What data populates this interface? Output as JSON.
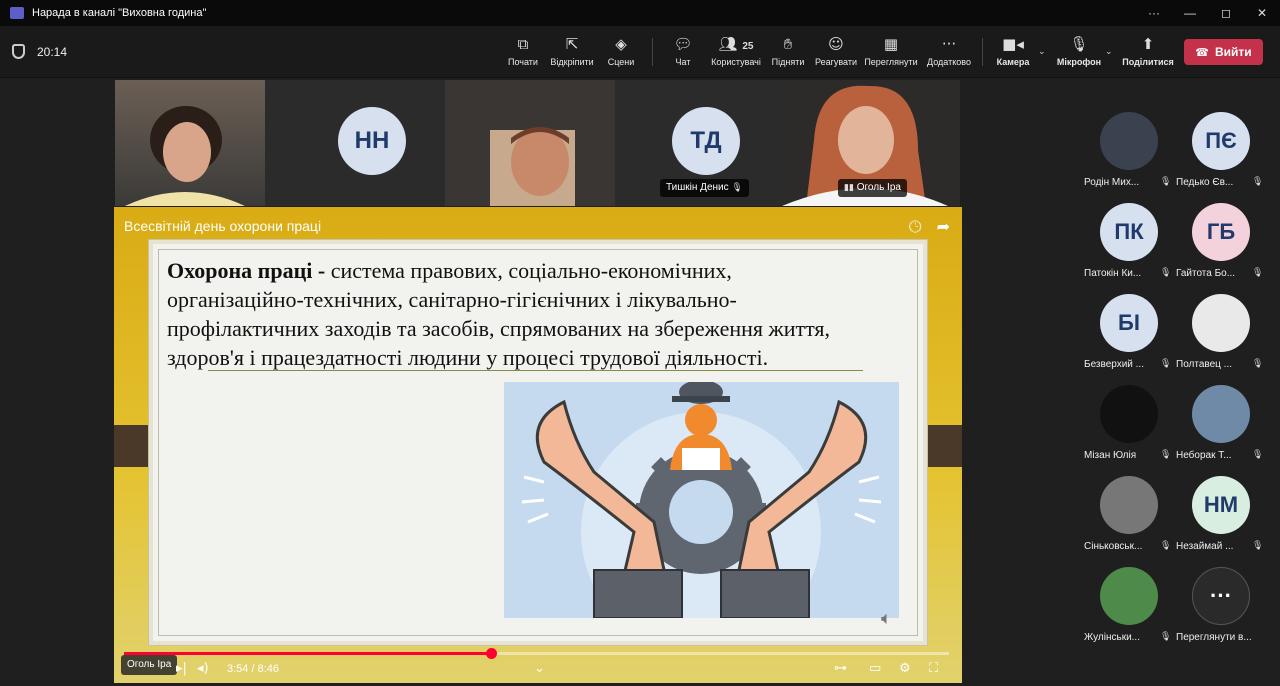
{
  "window": {
    "title": "Нарада в каналі \"Виховна година\"",
    "controls": [
      "···",
      "—",
      "◻",
      "✕"
    ]
  },
  "meeting": {
    "elapsed": "20:14"
  },
  "toolbar": {
    "record": "Почати",
    "open": "Відкріпити",
    "scenes": "Сцени",
    "chat": "Чат",
    "participants_count": "25",
    "participants": "Користувачі",
    "raise": "Підняти",
    "react": "Реагувати",
    "view": "Переглянути",
    "more": "Додатково",
    "camera": "Камера",
    "mic": "Мікрофон",
    "share": "Поділитися",
    "leave": "Вийти"
  },
  "strip": {
    "tile_nn": "НН",
    "tile_td": "ТД",
    "name_tishkin": "Тишкін Денис",
    "name_ogol": "Оголь Іра"
  },
  "share": {
    "video_title": "Всесвітній день охорони праці",
    "slide_bold": "Охорона праці -",
    "slide_text": " система правових, соціально-економічних, організаційно-технічних, санітарно-гігієнічних і лікувально-профілактичних заходів та засобів, спрямованих на збереження життя, здоров'я і працездатності людини у процесі трудової діяльності.",
    "time": "3:54 / 8:46",
    "progress_fraction": 0.445,
    "presenter_tag": "Оголь Іра"
  },
  "people": [
    {
      "initials": "",
      "name": "Родін Мих...",
      "color": "#3a4250"
    },
    {
      "initials": "ПЄ",
      "name": "Педько Єв...",
      "color": "#d6e0ef"
    },
    {
      "initials": "ПК",
      "name": "Патокін Ки...",
      "color": "#d6e0ef"
    },
    {
      "initials": "ГБ",
      "name": "Гайтота Бо...",
      "color": "#f4d2dc"
    },
    {
      "initials": "БІ",
      "name": "Безверхий ...",
      "color": "#d6e0ef"
    },
    {
      "initials": "",
      "name": "Полтавец ...",
      "color": "#e9e9e9"
    },
    {
      "initials": "",
      "name": "Мізан Юлія",
      "color": "#111111"
    },
    {
      "initials": "",
      "name": "Неборак Т...",
      "color": "#6f8aa6"
    },
    {
      "initials": "",
      "name": "Сіньковськ...",
      "color": "#777777"
    },
    {
      "initials": "НМ",
      "name": "Незаймай ...",
      "color": "#d8eee0"
    },
    {
      "initials": "",
      "name": "Жулінськи...",
      "color": "#4e8a4a"
    },
    {
      "initials": "···",
      "name": "Переглянути в...",
      "color": "#2a2a2a"
    }
  ]
}
